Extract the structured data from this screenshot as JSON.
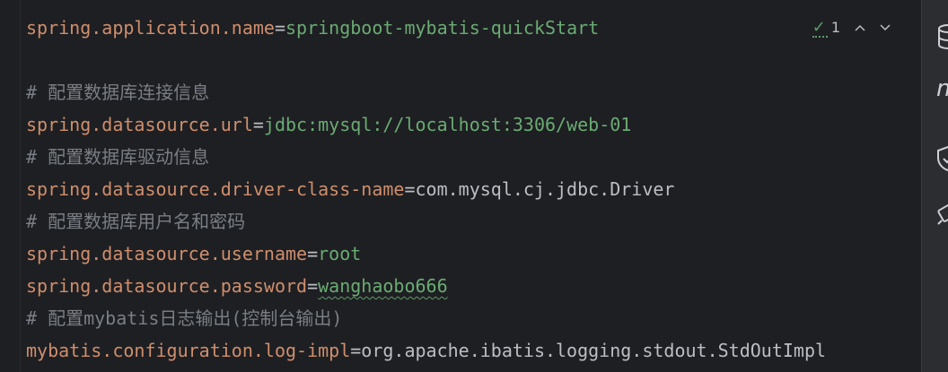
{
  "editor": {
    "lines": [
      {
        "key": "spring.application.name",
        "eq": "=",
        "value": "springboot-mybatis-quickStart",
        "value_style": "green"
      },
      {
        "blank": true
      },
      {
        "comment": "# 配置数据库连接信息"
      },
      {
        "key": "spring.datasource.url",
        "eq": "=",
        "value": "jdbc:mysql://localhost:3306/web-01",
        "value_style": "green"
      },
      {
        "comment": "# 配置数据库驱动信息"
      },
      {
        "key": "spring.datasource.driver-class-name",
        "eq": "=",
        "value": "com.mysql.cj.jdbc.Driver",
        "value_style": "plain"
      },
      {
        "comment": "# 配置数据库用户名和密码"
      },
      {
        "key": "spring.datasource.username",
        "eq": "=",
        "value": "root",
        "value_style": "green"
      },
      {
        "key": "spring.datasource.password",
        "eq": "=",
        "value": "wanghaobo666",
        "value_style": "green",
        "squiggle": true
      },
      {
        "comment": "# 配置mybatis日志输出(控制台输出)"
      },
      {
        "key": "mybatis.configuration.log-impl",
        "eq": "=",
        "value": "org.apache.ibatis.logging.stdout.StdOutImpl",
        "value_style": "plain"
      }
    ]
  },
  "inspections": {
    "icon": "check-icon",
    "count": "1",
    "prev_icon": "chevron-up-icon",
    "next_icon": "chevron-down-icon"
  },
  "tool_window_icons": [
    "database-icon",
    "maven-icon",
    "shield-icon",
    "plugin-icon"
  ],
  "colors": {
    "background": "#1e1f22",
    "key": "#cf8e6d",
    "string_value": "#6aab73",
    "plain_value": "#bcbec4",
    "comment": "#7a7e85",
    "check": "#5f9a6a"
  }
}
